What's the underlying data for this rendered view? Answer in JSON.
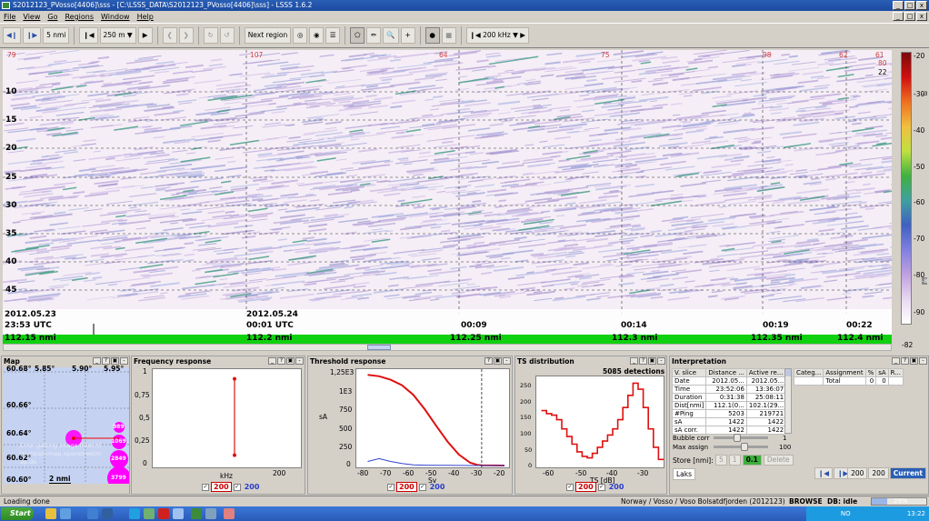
{
  "window": {
    "title": "S2012123_PVosso[4406]\\sss - [C:\\LSSS_DATA\\S2012123_PVosso[4406]\\sss] - LSSS 1.6.2",
    "min": "_",
    "max": "□",
    "close": "x",
    "child_min": "_",
    "child_max": "□",
    "child_close": "x"
  },
  "menu": [
    "File",
    "View",
    "Go",
    "Regions",
    "Window",
    "Help"
  ],
  "toolbar": {
    "step_label": "5 nmi",
    "range_label": "250 m",
    "next_region": "Next region",
    "frequency": "200 kHz"
  },
  "echogram": {
    "depth_ticks": [
      "10",
      "15",
      "20",
      "25",
      "30",
      "35",
      "40",
      "45"
    ],
    "top_markers": [
      "79",
      "107",
      "64",
      "75",
      "98",
      "62",
      "61"
    ],
    "right_markers": [
      "80",
      "22"
    ],
    "dates": [
      {
        "date": "2012.05.23",
        "time": "23:53 UTC"
      },
      {
        "date": "2012.05.24",
        "time": "00:01 UTC"
      }
    ],
    "times": [
      "00:09",
      "00:14",
      "00:19",
      "00:22"
    ],
    "distances": [
      "112.15 nmi",
      "112.2 nmi",
      "112.25 nmi",
      "112.3 nmi",
      "112.35 nmi",
      "112.4 nmi"
    ]
  },
  "colorbar": {
    "ticks": [
      "-20",
      "-30",
      "-40",
      "-50",
      "-60",
      "-70",
      "-80",
      "-90"
    ],
    "side_labels": [
      "-3",
      "-8"
    ],
    "bottom_value": "-82",
    "colors": [
      "#7a0a0a",
      "#d01010",
      "#f07020",
      "#f0c040",
      "#c0e040",
      "#40b040",
      "#40a0a0",
      "#4060c0",
      "#8080e0",
      "#c0a0e0",
      "#e8d8f0",
      "#ffffff"
    ]
  },
  "map_panel": {
    "title": "Map",
    "lat_labels": [
      "60.68°",
      "60.66°",
      "60.64°",
      "60.62°",
      "60.60°"
    ],
    "lon_labels": [
      "5.85°",
      "5.90°",
      "5.95°"
    ],
    "bubble_labels": [
      "989",
      "1069",
      "2849",
      "3799"
    ],
    "scale": "2 nmi",
    "watermark": "Error getting image from http://staticmap.openstreetmap.de",
    "bubble_color": "#ff00ff"
  },
  "freq_panel": {
    "title": "Frequency response",
    "yticks": [
      "1",
      "0,75",
      "0,5",
      "0,25",
      "0"
    ],
    "xtick": "200",
    "xlabel": "kHz"
  },
  "threshold_panel": {
    "title": "Threshold response",
    "yticks": [
      "1,25E3",
      "1E3",
      "750",
      "500",
      "250",
      "0"
    ],
    "xticks": [
      "-80",
      "-70",
      "-60",
      "-50",
      "-40",
      "-30",
      "-20"
    ],
    "ylabel": "sA",
    "xlabel": "Sv"
  },
  "ts_panel": {
    "title": "TS distribution",
    "detections": "5085 detections",
    "yticks": [
      "250",
      "200",
      "150",
      "100",
      "50",
      "0"
    ],
    "xticks": [
      "-60",
      "-50",
      "-40",
      "-30"
    ],
    "xlabel": "TS [dB]"
  },
  "chart_data": [
    {
      "type": "line",
      "title": "Frequency response",
      "xlabel": "kHz",
      "ylabel": "",
      "x": [
        200,
        200
      ],
      "series": [
        {
          "values": [
            1.0,
            0.08
          ]
        }
      ],
      "ylim": [
        0,
        1.05
      ],
      "colors": [
        "#e01010"
      ]
    },
    {
      "type": "line",
      "title": "Threshold response",
      "xlabel": "Sv",
      "ylabel": "sA",
      "x": [
        -80,
        -75,
        -70,
        -65,
        -60,
        -55,
        -50,
        -45,
        -40,
        -35,
        -32,
        -30,
        -25,
        -20
      ],
      "series": [
        {
          "values": [
            1320,
            1300,
            1250,
            1170,
            1030,
            820,
            580,
            350,
            160,
            40,
            10,
            3,
            1,
            0
          ]
        },
        {
          "values": [
            60,
            100,
            60,
            30,
            10,
            5,
            3,
            2,
            1,
            0,
            0,
            0,
            0,
            0
          ]
        }
      ],
      "xlim": [
        -85,
        -18
      ],
      "ylim": [
        0,
        1350
      ],
      "threshold_line": -30,
      "colors": [
        "#e01010",
        "#3344cc"
      ]
    },
    {
      "type": "line",
      "title": "TS distribution",
      "xlabel": "TS [dB]",
      "ylabel": "",
      "x": [
        -68,
        -66,
        -64,
        -62,
        -60,
        -58,
        -56,
        -54,
        -52,
        -50,
        -48,
        -46,
        -44,
        -42,
        -40,
        -38,
        -36,
        -34,
        -32,
        -30,
        -28,
        -26,
        -24,
        -22
      ],
      "series": [
        {
          "values": [
            180,
            170,
            165,
            150,
            120,
            95,
            70,
            45,
            30,
            25,
            40,
            60,
            80,
            100,
            120,
            150,
            190,
            230,
            270,
            250,
            190,
            120,
            60,
            20
          ]
        }
      ],
      "xlim": [
        -70,
        -20
      ],
      "ylim": [
        0,
        280
      ],
      "colors": [
        "#e01010"
      ]
    }
  ],
  "panel_freq_buttons": {
    "first": "200",
    "second": "200"
  },
  "interpretation": {
    "title": "Interpretation",
    "headers": [
      "V. slice",
      "Distance ...",
      "Active re..."
    ],
    "rows": [
      [
        "Date",
        "2012.05...",
        "2012.05..."
      ],
      [
        "Time",
        "23:52:06",
        "13:36:07"
      ],
      [
        "Duration",
        "0:31:38",
        "25:08:11"
      ],
      [
        "Dist[nmi]",
        "112.1(0...",
        "102.1(29..."
      ],
      [
        "#Ping",
        "5203",
        "219721"
      ],
      [
        "sA",
        "1422",
        "1422"
      ],
      [
        "sA corr.",
        "1422",
        "1422"
      ]
    ],
    "bubble_corr_label": "Bubble corr",
    "bubble_corr_value": "1",
    "max_assign_label": "Max assign",
    "max_assign_value": "100",
    "store_label": "Store [nmi]:",
    "store_options": [
      "5",
      "1",
      "0.1"
    ],
    "delete_label": "Delete",
    "laks": "Laks",
    "assign_headers": [
      "Categ...",
      "Assignment",
      "%",
      "sA",
      "R..."
    ],
    "assign_row": [
      "",
      "Total",
      "0",
      "0"
    ],
    "right_buttons": [
      "200",
      "200",
      "Current"
    ]
  },
  "statusbar": {
    "message": "Loading done",
    "survey": "Norway / Vosso / Voso Bolsatdfjorden (2012123)",
    "mode": "BROWSE",
    "db": "DB: idle",
    "progress": "29%",
    "progress_value": 0.29
  },
  "taskbar": {
    "start": "Start",
    "lang": "NO",
    "clock": "13:22"
  }
}
